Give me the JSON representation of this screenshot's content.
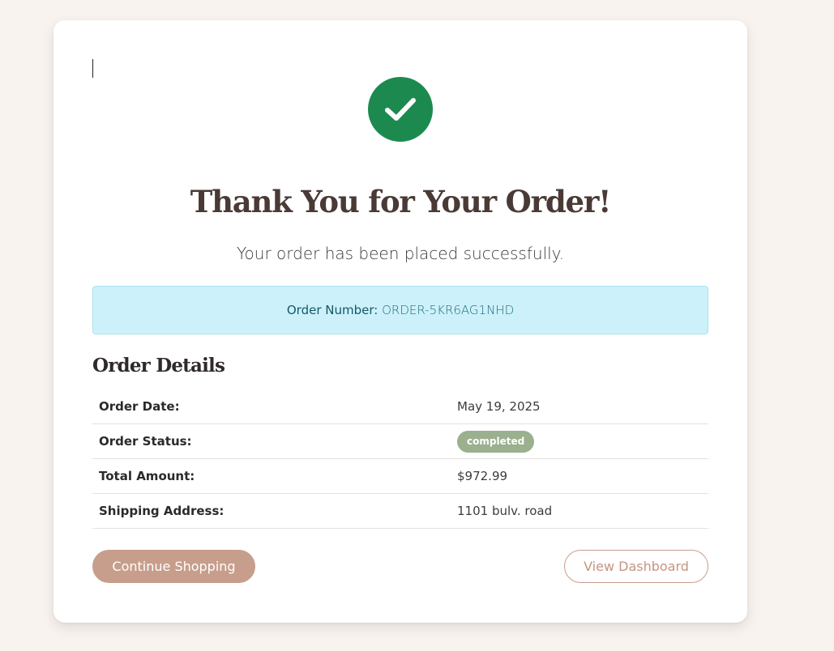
{
  "colors": {
    "page_background": "#f8f3ef",
    "success_icon": "#1c8a4e",
    "info_box_background": "#cdf1fa",
    "status_badge": "#9ab08f",
    "primary_button": "#c79e8b"
  },
  "icons": {
    "success": "checkmark-circle-icon"
  },
  "confirmation": {
    "title": "Thank You for Your Order!",
    "subtitle": "Your order has been placed successfully.",
    "order_number_label": "Order Number:",
    "order_number_value": "ORDER-5KR6AG1NHD"
  },
  "details": {
    "heading": "Order Details",
    "rows": [
      {
        "label": "Order Date:",
        "value": "May 19, 2025"
      },
      {
        "label": "Order Status:",
        "value": "completed"
      },
      {
        "label": "Total Amount:",
        "value": "$972.99"
      },
      {
        "label": "Shipping Address:",
        "value": "1101 bulv. road"
      }
    ]
  },
  "actions": {
    "continue_label": "Continue Shopping",
    "dashboard_label": "View Dashboard"
  }
}
